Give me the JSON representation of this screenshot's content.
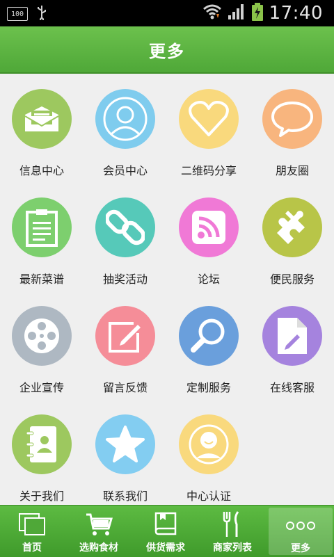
{
  "status_bar": {
    "battery_text": "100",
    "time": "17:40",
    "icons": [
      "usb-icon",
      "wifi-icon",
      "signal-icon",
      "battery-charging-icon"
    ]
  },
  "header": {
    "title": "更多"
  },
  "grid": {
    "items": [
      {
        "label": "信息中心",
        "icon": "envelope-icon",
        "color": "#9dc85f"
      },
      {
        "label": "会员中心",
        "icon": "user-silhouette-icon",
        "color": "#7fccee"
      },
      {
        "label": "二维码分享",
        "icon": "heart-icon",
        "color": "#f9d97d"
      },
      {
        "label": "朋友圈",
        "icon": "speech-bubble-icon",
        "color": "#f8b57e"
      },
      {
        "label": "最新菜谱",
        "icon": "clipboard-icon",
        "color": "#7dcf6e"
      },
      {
        "label": "抽奖活动",
        "icon": "chain-link-icon",
        "color": "#56c9b9"
      },
      {
        "label": "论坛",
        "icon": "rss-icon",
        "color": "#f079d6"
      },
      {
        "label": "便民服务",
        "icon": "puzzle-icon",
        "color": "#b8c548"
      },
      {
        "label": "企业宣传",
        "icon": "film-reel-icon",
        "color": "#aeb8c2"
      },
      {
        "label": "留言反馈",
        "icon": "edit-note-icon",
        "color": "#f58d98"
      },
      {
        "label": "定制服务",
        "icon": "magnifier-icon",
        "color": "#6a9fdc"
      },
      {
        "label": "在线客服",
        "icon": "document-pen-icon",
        "color": "#a583de"
      },
      {
        "label": "关于我们",
        "icon": "contact-book-icon",
        "color": "#9dc85f"
      },
      {
        "label": "联系我们",
        "icon": "star-icon",
        "color": "#83cdf1"
      },
      {
        "label": "中心认证",
        "icon": "person-smile-icon",
        "color": "#f9d97d"
      }
    ]
  },
  "bottom_nav": {
    "items": [
      {
        "label": "首页",
        "icon": "windows-icon",
        "active": false
      },
      {
        "label": "选购食材",
        "icon": "cart-icon",
        "active": false
      },
      {
        "label": "供货需求",
        "icon": "book-icon",
        "active": false
      },
      {
        "label": "商家列表",
        "icon": "fork-knife-icon",
        "active": false
      },
      {
        "label": "更多",
        "icon": "more-dots-icon",
        "active": true
      }
    ]
  }
}
